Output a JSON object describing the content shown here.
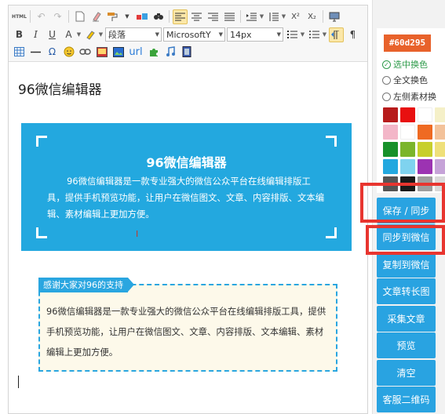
{
  "toolbar": {
    "html_label": "HTML",
    "paragraph_select": "段落",
    "font_family_select": "MicrosoftY",
    "font_size_select": "14px",
    "url_label": "url",
    "bold": "B",
    "italic": "I",
    "underline": "U",
    "font_color": "A",
    "subscript": "X₂",
    "superscript": "X²",
    "omega": "Ω",
    "pilcrow": "¶"
  },
  "document": {
    "title": "96微信编辑器",
    "blue_card": {
      "title": "96微信编辑器",
      "body": "96微信编辑器是一款专业强大的微信公众平台在线编辑排版工具，提供手机预览功能，让用户在微信图文、文章、内容排版、文本编辑、素材编辑上更加方便。",
      "cursor_glyph": "I",
      "bg_color": "#23a8df"
    },
    "thanks": {
      "tag": "感谢大家对96的支持",
      "body": "96微信编辑器是一款专业强大的微信公众平台在线编辑排版工具，提供手机预览功能，让用户在微信图文、文章、内容排版、文本编辑、素材编辑上更加方便。"
    }
  },
  "panel": {
    "hex_value": "#60d295",
    "radio_options": [
      {
        "label": "选中换色",
        "selected": true
      },
      {
        "label": "全文换色",
        "selected": false
      },
      {
        "label": "左侧素材换",
        "selected": false
      }
    ],
    "swatches": [
      "#b71c1c",
      "#e81010",
      "#ffffff",
      "#f5f0c8",
      "#f3b6c8",
      "#ffffff",
      "#ef6a22",
      "#f3c29a",
      "#17912a",
      "#7bb52b",
      "#c7cf2c",
      "#efe07a",
      "#23a8df",
      "#7fd3ef",
      "#9c33b2",
      "#c6a3d8",
      "#555555",
      "#1a1a1a",
      "#9e9e9e",
      "#d9d9d9"
    ],
    "buttons": [
      "保存 / 同步",
      "同步到微信",
      "复制到微信",
      "文章转长图",
      "采集文章",
      "预览",
      "清空",
      "客服二维码"
    ],
    "accent_color": "#29a3e1",
    "highlight_color": "#e8352f"
  }
}
